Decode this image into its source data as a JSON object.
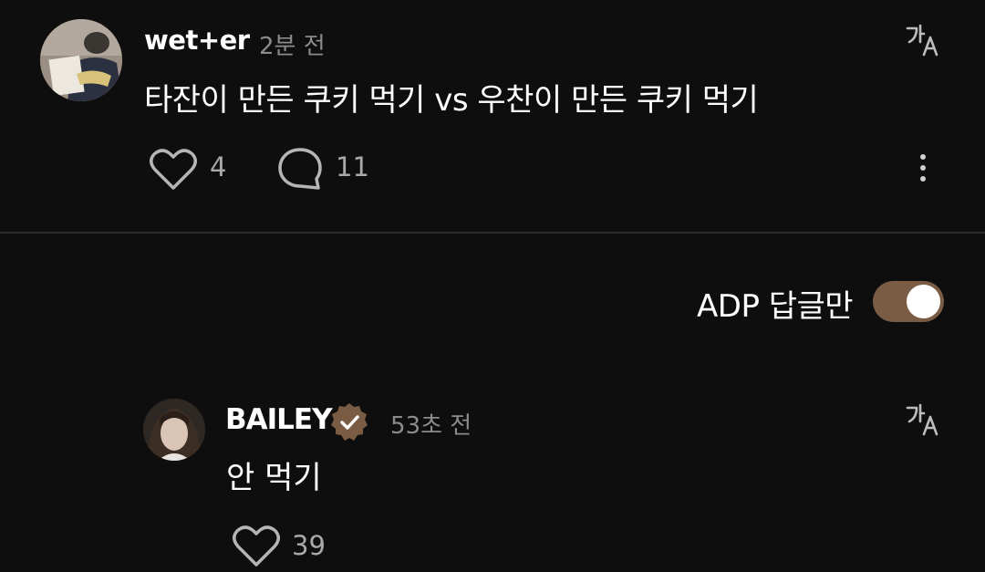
{
  "post": {
    "username": "wet+er",
    "time": "2분 전",
    "text": "타잔이 만든 쿠키 먹기 vs 우찬이 만든 쿠키 먹기",
    "likes": "4",
    "replies": "11"
  },
  "filter": {
    "label": "ADP 답글만",
    "enabled": true
  },
  "reply": {
    "username": "BAILEY",
    "time": "53초 전",
    "text": "안 먹기",
    "likes": "39",
    "verified": true
  },
  "colors": {
    "background": "#0f0e0e",
    "accent": "#7a5c45",
    "muted": "#8b8b8b"
  },
  "icons": [
    "translate-icon",
    "heart-icon",
    "comment-icon",
    "more-icon",
    "verified-badge-icon"
  ]
}
